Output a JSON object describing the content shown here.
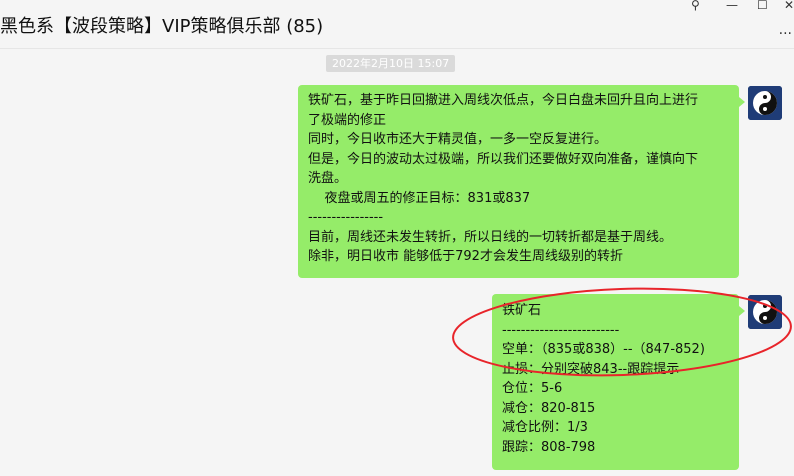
{
  "window": {
    "title": "黑色系【波段策略】VIP策略俱乐部  (85)",
    "controls": {
      "pin": "⚲",
      "minimize": "—",
      "maximize": "☐",
      "close": "✕",
      "more": "..."
    }
  },
  "timestamp": "2022年2月10日 15:07",
  "messages": [
    {
      "lines": [
        "铁矿石，基于昨日回撤进入周线次低点，今日白盘未回升且向上进行",
        "了极端的修正",
        "同时，今日收市还大于精灵值，一多一空反复进行。",
        "但是，今日的波动太过极端，所以我们还要做好双向准备，谨慎向下",
        "洗盘。",
        "    夜盘或周五的修正目标：831或837",
        "----------------",
        "目前，周线还未发生转折，所以日线的一切转折都是基于周线。",
        "除非，明日收市 能够低于792才会发生周线级别的转折"
      ]
    },
    {
      "lines": [
        "铁矿石",
        "-------------------------",
        "空单：（835或838）--（847-852)",
        "止损：分别突破843--跟踪提示",
        "仓位：5-6",
        "减仓：820-815",
        "减仓比例：1/3",
        "跟踪：808-798"
      ]
    }
  ],
  "colors": {
    "bubble": "#95ec69",
    "background": "#f5f5f5",
    "annotation": "#e8242a",
    "avatar": "#1f3c77"
  },
  "icons": {
    "avatar": "yin-yang-avatar-icon"
  }
}
